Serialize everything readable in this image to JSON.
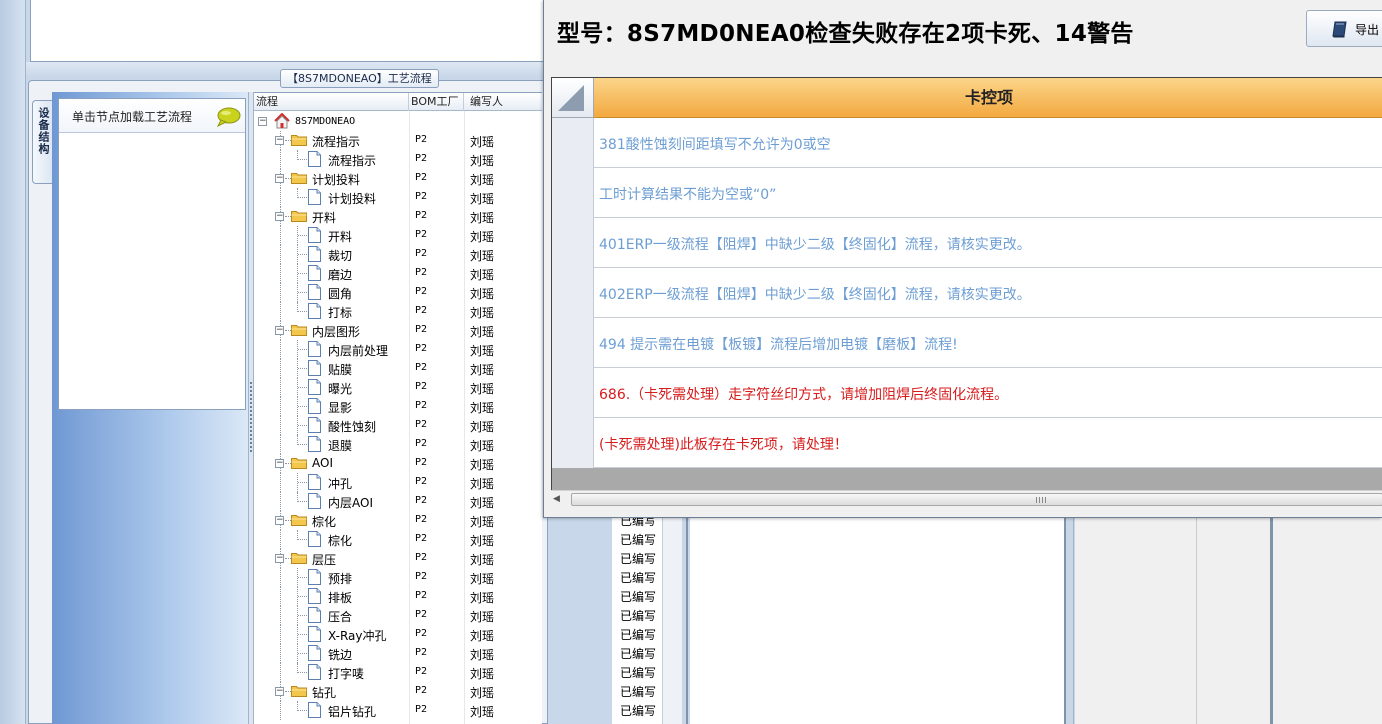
{
  "process_panel": {
    "group_title": "【8S7MDONEAO】工艺流程",
    "side_tab_label": "设备结构",
    "hint_text": "单击节点加载工艺流程"
  },
  "tree_grid": {
    "columns": [
      "流程",
      "BOM工厂",
      "编写人"
    ],
    "rows": [
      {
        "label": "8S7MDONEAO",
        "type": "root",
        "level": 0,
        "factory": "",
        "author": ""
      },
      {
        "label": "流程指示",
        "type": "folder",
        "level": 1,
        "factory": "P2",
        "author": "刘瑶"
      },
      {
        "label": "流程指示",
        "type": "doc",
        "level": 2,
        "factory": "P2",
        "author": "刘瑶"
      },
      {
        "label": "计划投料",
        "type": "folder",
        "level": 1,
        "factory": "P2",
        "author": "刘瑶"
      },
      {
        "label": "计划投料",
        "type": "doc",
        "level": 2,
        "factory": "P2",
        "author": "刘瑶"
      },
      {
        "label": "开料",
        "type": "folder",
        "level": 1,
        "factory": "P2",
        "author": "刘瑶"
      },
      {
        "label": "开料",
        "type": "doc",
        "level": 2,
        "factory": "P2",
        "author": "刘瑶"
      },
      {
        "label": "裁切",
        "type": "doc",
        "level": 2,
        "factory": "P2",
        "author": "刘瑶"
      },
      {
        "label": "磨边",
        "type": "doc",
        "level": 2,
        "factory": "P2",
        "author": "刘瑶"
      },
      {
        "label": "圆角",
        "type": "doc",
        "level": 2,
        "factory": "P2",
        "author": "刘瑶"
      },
      {
        "label": "打标",
        "type": "doc",
        "level": 2,
        "factory": "P2",
        "author": "刘瑶"
      },
      {
        "label": "内层图形",
        "type": "folder",
        "level": 1,
        "factory": "P2",
        "author": "刘瑶"
      },
      {
        "label": "内层前处理",
        "type": "doc",
        "level": 2,
        "factory": "P2",
        "author": "刘瑶"
      },
      {
        "label": "贴膜",
        "type": "doc",
        "level": 2,
        "factory": "P2",
        "author": "刘瑶"
      },
      {
        "label": "曝光",
        "type": "doc",
        "level": 2,
        "factory": "P2",
        "author": "刘瑶"
      },
      {
        "label": "显影",
        "type": "doc",
        "level": 2,
        "factory": "P2",
        "author": "刘瑶"
      },
      {
        "label": "酸性蚀刻",
        "type": "doc",
        "level": 2,
        "factory": "P2",
        "author": "刘瑶"
      },
      {
        "label": "退膜",
        "type": "doc",
        "level": 2,
        "factory": "P2",
        "author": "刘瑶"
      },
      {
        "label": "AOI",
        "type": "folder",
        "level": 1,
        "factory": "P2",
        "author": "刘瑶"
      },
      {
        "label": "冲孔",
        "type": "doc",
        "level": 2,
        "factory": "P2",
        "author": "刘瑶"
      },
      {
        "label": "内层AOI",
        "type": "doc",
        "level": 2,
        "factory": "P2",
        "author": "刘瑶"
      },
      {
        "label": "棕化",
        "type": "folder",
        "level": 1,
        "factory": "P2",
        "author": "刘瑶"
      },
      {
        "label": "棕化",
        "type": "doc",
        "level": 2,
        "factory": "P2",
        "author": "刘瑶"
      },
      {
        "label": "层压",
        "type": "folder",
        "level": 1,
        "factory": "P2",
        "author": "刘瑶"
      },
      {
        "label": "预排",
        "type": "doc",
        "level": 2,
        "factory": "P2",
        "author": "刘瑶"
      },
      {
        "label": "排板",
        "type": "doc",
        "level": 2,
        "factory": "P2",
        "author": "刘瑶"
      },
      {
        "label": "压合",
        "type": "doc",
        "level": 2,
        "factory": "P2",
        "author": "刘瑶"
      },
      {
        "label": "X-Ray冲孔",
        "type": "doc",
        "level": 2,
        "factory": "P2",
        "author": "刘瑶"
      },
      {
        "label": "铣边",
        "type": "doc",
        "level": 2,
        "factory": "P2",
        "author": "刘瑶"
      },
      {
        "label": "打字唛",
        "type": "doc",
        "level": 2,
        "factory": "P2",
        "author": "刘瑶"
      },
      {
        "label": "钻孔",
        "type": "folder",
        "level": 1,
        "factory": "P2",
        "author": "刘瑶"
      },
      {
        "label": "铝片钻孔",
        "type": "doc",
        "level": 2,
        "factory": "P2",
        "author": "刘瑶"
      }
    ]
  },
  "status_column": {
    "values": [
      "已编写",
      "已编写",
      "已编写",
      "已编写",
      "已编写",
      "已编写",
      "已编写",
      "已编写",
      "已编写",
      "已编写",
      "已编写"
    ]
  },
  "dialog": {
    "title": "型号：8S7MD0NEA0检查失败存在2项卡死、14警告",
    "export_label": "导出",
    "grid_header": "卡控项",
    "items": [
      {
        "text": "381酸性蚀刻间距填写不允许为0或空",
        "severity": "warning"
      },
      {
        "text": "工时计算结果不能为空或“0”",
        "severity": "warning"
      },
      {
        "text": "401ERP一级流程【阻焊】中缺少二级【终固化】流程，请核实更改。",
        "severity": "warning"
      },
      {
        "text": "402ERP一级流程【阻焊】中缺少二级【终固化】流程，请核实更改。",
        "severity": "warning"
      },
      {
        "text": "494 提示需在电镀【板镀】流程后增加电镀【磨板】流程!",
        "severity": "warning"
      },
      {
        "text": "686.（卡死需处理）走字符丝印方式，请增加阻焊后终固化流程。",
        "severity": "error"
      },
      {
        "text": "(卡死需处理)此板存在卡死项，请处理！",
        "severity": "error"
      }
    ]
  },
  "colors": {
    "warning_text": "#6d9ed3",
    "error_text": "#d81b1b",
    "header_orange": "#f3a940"
  }
}
